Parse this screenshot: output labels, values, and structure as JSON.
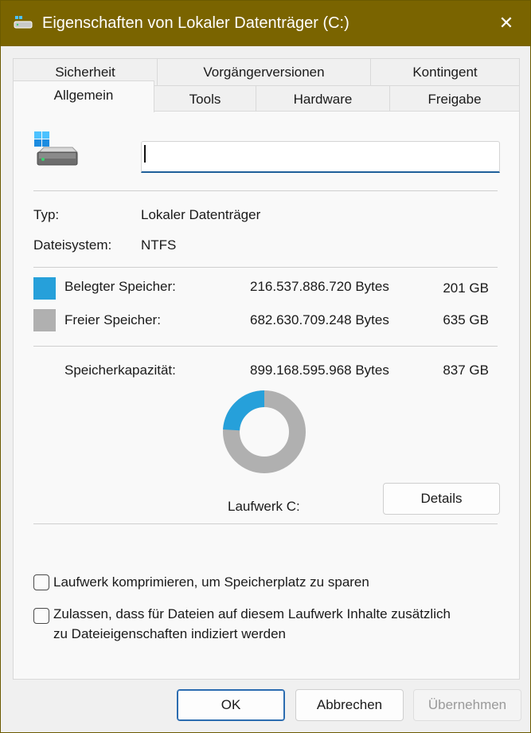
{
  "window": {
    "title": "Eigenschaften von Lokaler Datenträger (C:)",
    "close_glyph": "✕",
    "accent": "#7a6400"
  },
  "tabs": {
    "row1": [
      "Sicherheit",
      "Vorgängerversionen",
      "Kontingent"
    ],
    "row2": [
      "Allgemein",
      "Tools",
      "Hardware",
      "Freigabe"
    ],
    "active": "Allgemein"
  },
  "general": {
    "name_value": "",
    "type_label": "Typ:",
    "type_value": "Lokaler Datenträger",
    "fs_label": "Dateisystem:",
    "fs_value": "NTFS",
    "used": {
      "label": "Belegter Speicher:",
      "bytes": "216.537.886.720 Bytes",
      "size": "201 GB",
      "color": "#26a0da"
    },
    "free": {
      "label": "Freier Speicher:",
      "bytes": "682.630.709.248 Bytes",
      "size": "635 GB",
      "color": "#b0b0b0"
    },
    "capacity": {
      "label": "Speicherkapazität:",
      "bytes": "899.168.595.968 Bytes",
      "size": "837 GB"
    },
    "drive_label": "Laufwerk C:",
    "details_button": "Details",
    "used_fraction": 0.241
  },
  "options": {
    "compress_label": "Laufwerk komprimieren, um Speicherplatz zu sparen",
    "compress_checked": false,
    "index_label_line1": "Zulassen, dass für Dateien auf diesem Laufwerk Inhalte zusätzlich",
    "index_label_line2": "zu Dateieigenschaften indiziert werden",
    "index_checked": false
  },
  "footer": {
    "ok": "OK",
    "cancel": "Abbrechen",
    "apply": "Übernehmen"
  },
  "icons": {
    "title": "drive-icon",
    "drive": "windows-drive-icon"
  }
}
